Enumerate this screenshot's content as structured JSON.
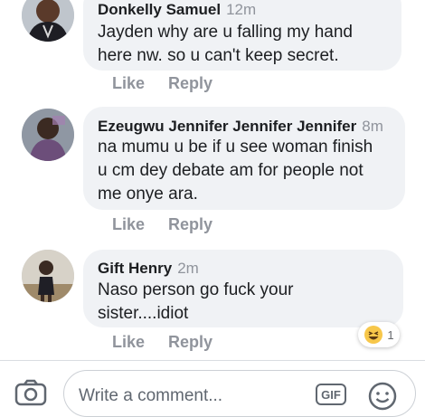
{
  "comments": [
    {
      "name": "Donkelly Samuel",
      "time": "12m",
      "lines": [
        "Jayden why are u falling my hand",
        "here nw. so u can't keep secret."
      ],
      "like": "Like",
      "reply": "Reply"
    },
    {
      "name": "Ezeugwu Jennifer Jennifer Jennifer",
      "time": "8m",
      "lines": [
        "na mumu u be if u see woman finish",
        "u cm dey debate am for people not",
        "me onye ara."
      ],
      "like": "Like",
      "reply": "Reply"
    },
    {
      "name": "Gift Henry",
      "time": "2m",
      "lines": [
        "Naso person go fuck your",
        "sister....idiot"
      ],
      "like": "Like",
      "reply": "Reply",
      "reaction": {
        "icon": "haha-emoji-icon",
        "count": "1"
      }
    }
  ],
  "composer": {
    "placeholder": "Write a comment...",
    "gif_label": "GIF"
  },
  "colors": {
    "bubble": "#f0f2f5",
    "meta": "#90949c",
    "text": "#1c1e21"
  }
}
